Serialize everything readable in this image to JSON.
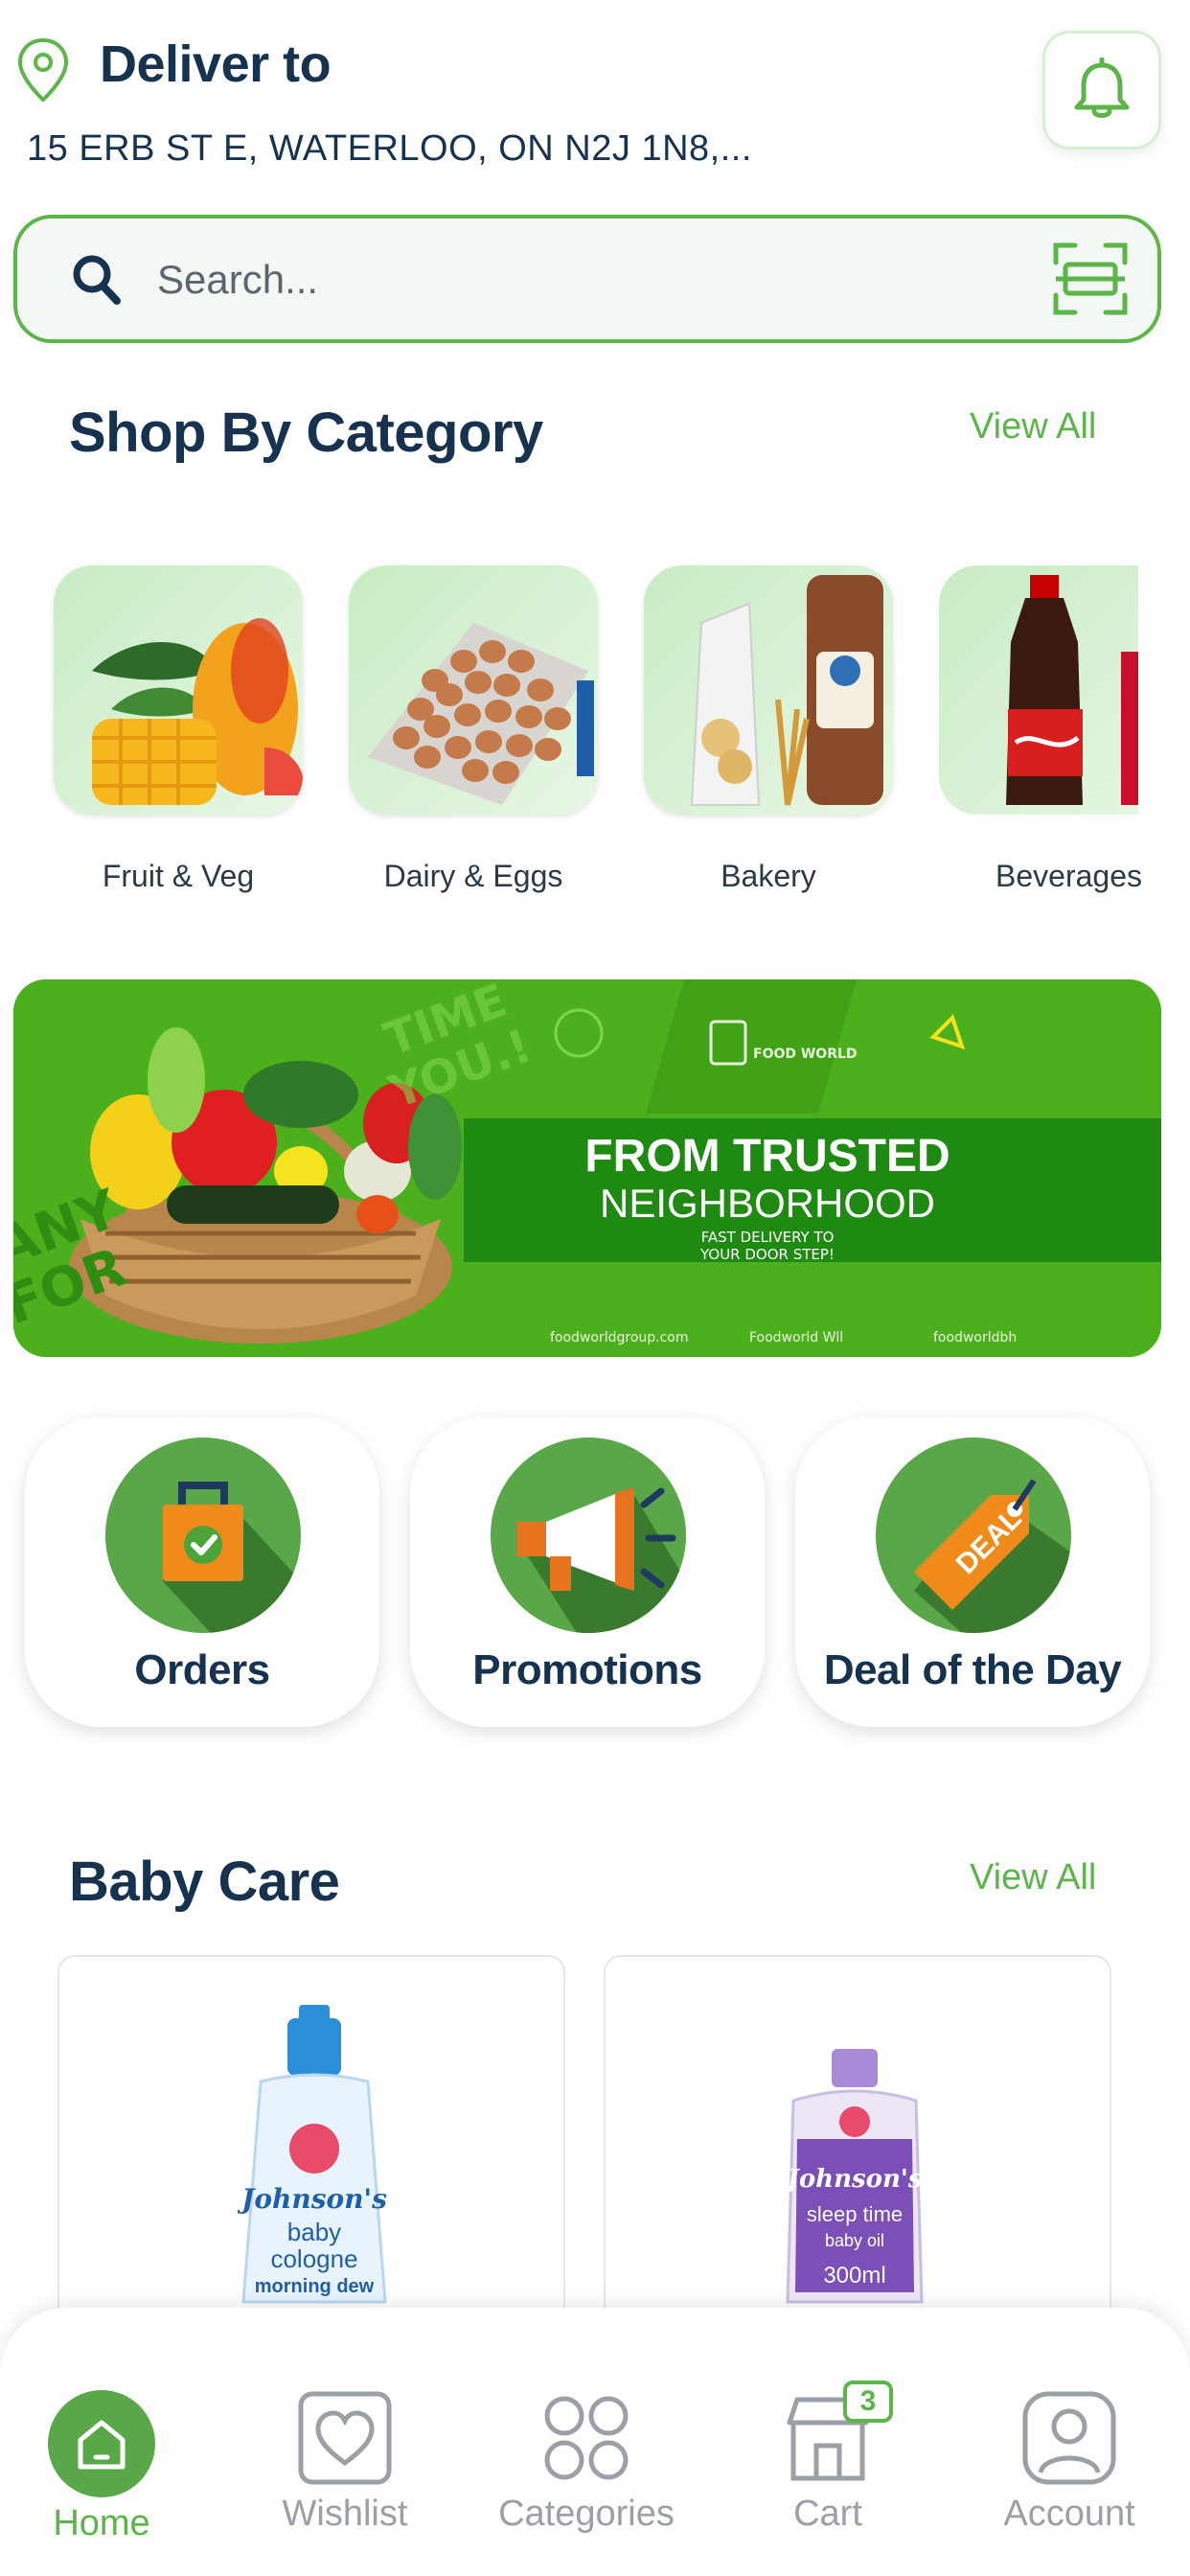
{
  "header": {
    "deliver_label": "Deliver to",
    "address": "15 ERB ST E, WATERLOO, ON N2J 1N8,..."
  },
  "search": {
    "placeholder": "Search..."
  },
  "categories_section": {
    "title": "Shop By Category",
    "view_all": "View All",
    "items": [
      {
        "label": "Fruit & Veg",
        "icon": "mango-image"
      },
      {
        "label": "Dairy & Eggs",
        "icon": "egg-tray-image"
      },
      {
        "label": "Bakery",
        "icon": "bread-image"
      },
      {
        "label": "Beverages",
        "icon": "cola-bottle-image"
      }
    ]
  },
  "banner": {
    "headline": "FROM TRUSTED",
    "subheadline": "NEIGHBORHOOD",
    "tagline_1": "FAST DELIVERY TO",
    "tagline_2": "YOUR DOOR STEP!",
    "bg_word_1": "TIME",
    "bg_word_2": "YOU.!",
    "bg_word_3": "ANY",
    "bg_word_4": "FOR",
    "logo_text": "FOOD WORLD",
    "footer_website": "foodworldgroup.com",
    "footer_facebook": "Foodworld Wll",
    "footer_instagram": "foodworldbh"
  },
  "quick_actions": [
    {
      "label": "Orders",
      "icon": "shopping-bag-check-icon"
    },
    {
      "label": "Promotions",
      "icon": "megaphone-icon"
    },
    {
      "label": "Deal of the Day",
      "icon": "deal-tag-icon"
    }
  ],
  "baby_care": {
    "title": "Baby Care",
    "view_all": "View All",
    "products": [
      {
        "brand": "Johnson's",
        "line1": "baby",
        "line2": "cologne",
        "line3": "morning dew"
      },
      {
        "brand": "Johnson's",
        "line1": "sleep time",
        "line2": "baby oil",
        "line3": "300ml"
      }
    ]
  },
  "bottom_nav": {
    "items": [
      {
        "label": "Home",
        "active": true
      },
      {
        "label": "Wishlist",
        "active": false
      },
      {
        "label": "Categories",
        "active": false
      },
      {
        "label": "Cart",
        "active": false,
        "badge": "3"
      },
      {
        "label": "Account",
        "active": false
      }
    ]
  },
  "colors": {
    "accent": "#5bb548",
    "navy": "#16324f",
    "banner_green": "#4caf1c"
  }
}
